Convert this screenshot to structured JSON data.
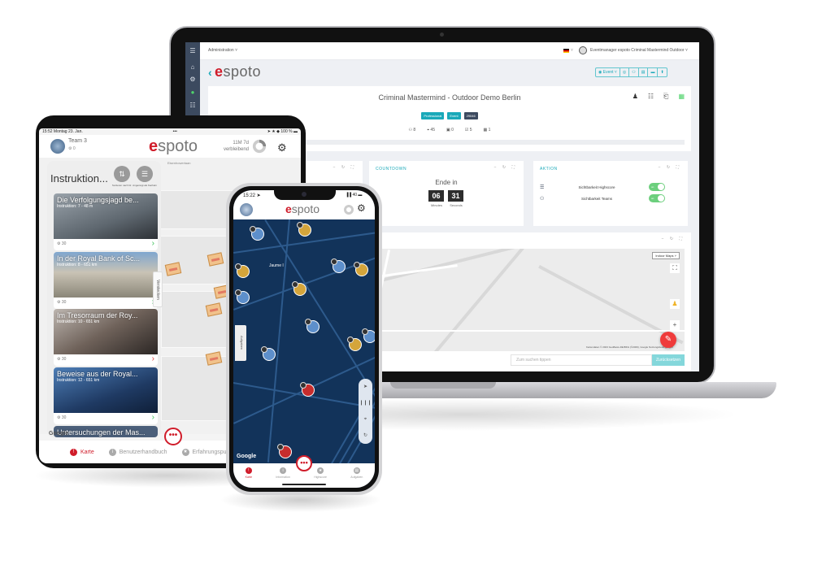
{
  "laptop": {
    "topbar": {
      "admin_menu": "Administration ˅",
      "language_dropdown": "˅",
      "user_menu": "Eventmanager espoto Criminal Mastermind Outdoor ˅"
    },
    "sidebar_icons": [
      "menu-icon",
      "home-icon",
      "settings-icon",
      "chat-icon",
      "list-icon"
    ],
    "logo": {
      "back": "‹",
      "e": "e",
      "rest": "spoto"
    },
    "toolbar": [
      {
        "label": "◉ Event ˅",
        "icon": "event-icon"
      },
      {
        "label": "◎",
        "icon": "location-icon"
      },
      {
        "label": "⚇",
        "icon": "users-icon"
      },
      {
        "label": "▤",
        "icon": "tasks-icon"
      },
      {
        "label": "▬",
        "icon": "list-icon"
      },
      {
        "label": "⬆",
        "icon": "trophy-icon"
      }
    ],
    "event": {
      "title": "Criminal Mastermind - Outdoor Demo Berlin",
      "badges": [
        "Professional",
        "Event",
        "29046"
      ],
      "stats": [
        {
          "icon": "teams-icon",
          "glyph": "⚇",
          "value": "8"
        },
        {
          "icon": "location-icon",
          "glyph": "⌖",
          "value": "45"
        },
        {
          "icon": "device-icon",
          "glyph": "▣",
          "value": "0"
        },
        {
          "icon": "checkbox-icon",
          "glyph": "☑",
          "value": "5"
        },
        {
          "icon": "photo-icon",
          "glyph": "▦",
          "value": "1"
        }
      ],
      "actions": [
        "♟",
        "☷",
        "⎗",
        "▦"
      ]
    },
    "card_controls": "− ↻ ⛶",
    "countdown": {
      "title": "COUNTDOWN",
      "label": "Ende in",
      "minutes": "06",
      "seconds": "31",
      "minutes_label": "Minutes",
      "seconds_label": "Seconds"
    },
    "aktion": {
      "title": "AKTION",
      "rows": [
        {
          "icon": "list-icon",
          "glyph": "☰",
          "label": "Sichtbarkeit Highscore",
          "toggle": "on"
        },
        {
          "icon": "teams-icon",
          "glyph": "⚇",
          "label": "Sichtbarkeit Teams",
          "toggle": "on"
        }
      ]
    },
    "map": {
      "indoor_maps": "Indoor Maps ˅",
      "fullscreen": "⛶",
      "pegman": "♟",
      "zoom_in": "+",
      "attribution": "Kartendaten © 2023 GeoBasis-DE/BKG (©2009), Google   Nutzungsbedingungen",
      "fab": "✎",
      "search_placeholder": "Zum suchen tippen",
      "reset_label": "Zurücksetzen"
    }
  },
  "tablet": {
    "status": {
      "left": "15:52  Montag 23. Jan.",
      "center": "•••",
      "right": "➤ ★ ◆ 100 % ▬"
    },
    "team": "Team 3",
    "points": "⚙ 0",
    "logo": {
      "e": "e",
      "rest": "spoto"
    },
    "remaining": [
      "11M 7d",
      "verbleibend"
    ],
    "gear": "⚙",
    "street_label": "Eisenhowerlaan",
    "panel": {
      "title": "Instruktion...",
      "sort_button": {
        "glyph": "⇅",
        "label": "Sortieren nach Nr."
      },
      "view_button": {
        "glyph": "☰",
        "label": "Angezeigt als Kacheln"
      }
    },
    "instructions": [
      {
        "title": "Die Verfolgungsjagd be...",
        "subtitle": "Instruktion: 7 - 48 m",
        "points": "30",
        "status": "done"
      },
      {
        "title": "In der Royal Bank of Sc...",
        "subtitle": "Instruktion: 8 - 651 km",
        "points": "30",
        "status": "done"
      },
      {
        "title": "Im Tresorraum der Roy...",
        "subtitle": "Instruktion: 10 - 651 km",
        "points": "30",
        "status": "failed"
      },
      {
        "title": "Beweise aus der Royal...",
        "subtitle": "Instruktion: 12 - 651 km",
        "points": "30",
        "status": "done"
      },
      {
        "title": "Untersuchungen der Mas...",
        "subtitle": "",
        "points": "",
        "status": ""
      }
    ],
    "hide_tab": "Verstecken",
    "google": "Google",
    "nav_glyph": "➤",
    "more": "•••",
    "tabs": [
      {
        "label": "Karte",
        "glyph": "!",
        "active": true
      },
      {
        "label": "Benutzerhandbuch",
        "glyph": "i",
        "active": false
      },
      {
        "label": "Erfahrungspunkte",
        "glyph": "★",
        "active": false
      }
    ]
  },
  "phone": {
    "time": "15:22 ➤",
    "signal": "▐▐ 40 ▬",
    "logo": {
      "e": "e",
      "rest": "spoto"
    },
    "gear": "⚙",
    "place_label": "Jaume I",
    "tasks_tab": "Aufgaben",
    "map_controls": [
      "➤",
      "❙❙❙",
      "⌖",
      "↻"
    ],
    "google": "Google",
    "more": "•••",
    "tabs": [
      {
        "label": "Karte",
        "glyph": "!",
        "active": true
      },
      {
        "label": "Information",
        "glyph": "i",
        "active": false
      },
      {
        "label": "Highscore",
        "glyph": "★",
        "active": false
      },
      {
        "label": "Aufgaben",
        "glyph": "▤",
        "active": false
      }
    ]
  },
  "colors": {
    "brand_red": "#d01c2a",
    "accent_teal": "#1aa9b9",
    "toggle_green": "#6ccf7d",
    "phone_map": "#12335a"
  }
}
